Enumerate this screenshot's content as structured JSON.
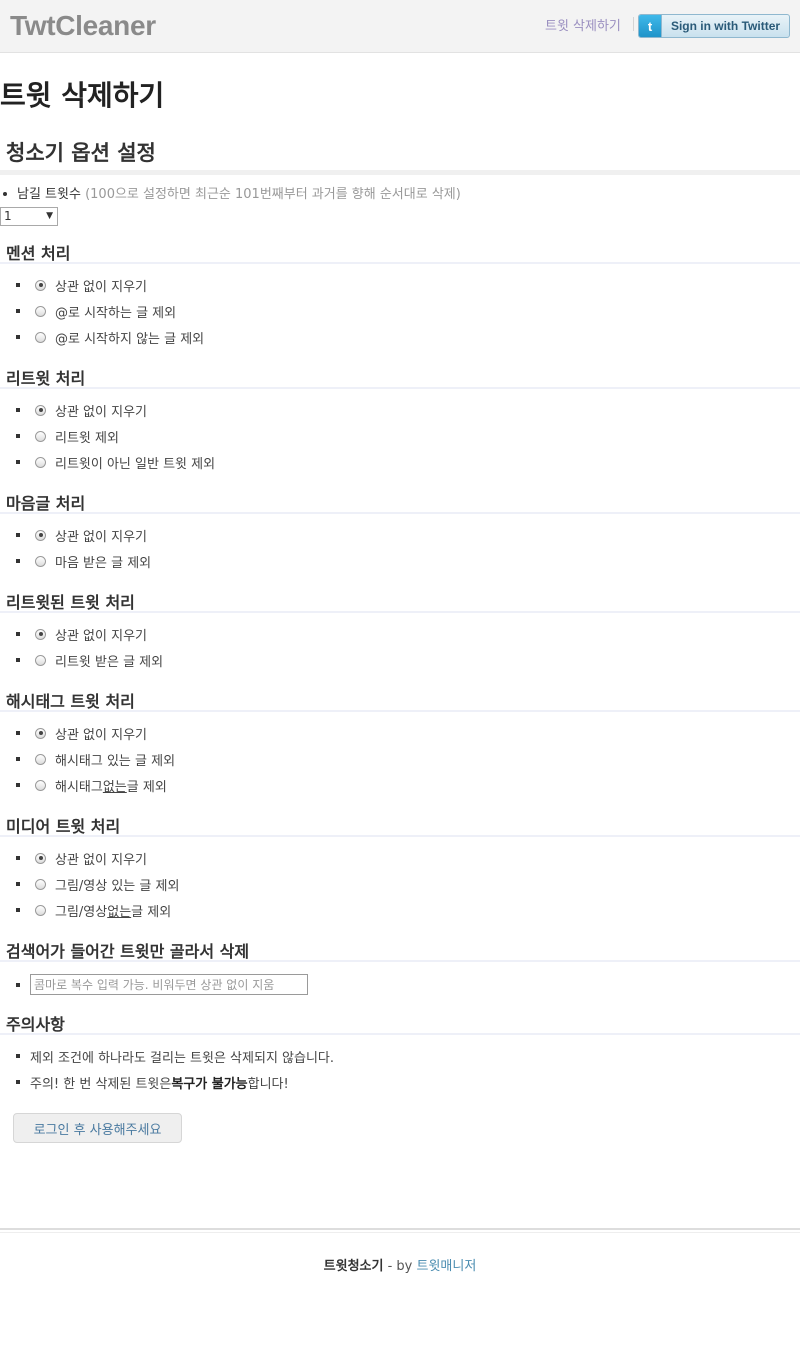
{
  "header": {
    "brand": "TwtCleaner",
    "nav_delete_link": "트윗 삭제하기",
    "signin_label": "Sign in with Twitter",
    "signin_icon": "t"
  },
  "page": {
    "title": "트윗 삭제하기",
    "section_title": "청소기 옵션 설정"
  },
  "keep": {
    "label": "남길 트윗수",
    "hint": "(100으로 설정하면 최근순 101번째부터 과거를 향해 순서대로 삭제)",
    "selected": "1"
  },
  "groups": {
    "mention": {
      "title": "멘션 처리",
      "options": [
        "상관 없이 지우기",
        "@로 시작하는 글 제외",
        "@로 시작하지 않는 글 제외"
      ],
      "selected_index": 0
    },
    "retweet": {
      "title": "리트윗 처리",
      "options": [
        "상관 없이 지우기",
        "리트윗 제외",
        "리트윗이 아닌 일반 트윗 제외"
      ],
      "selected_index": 0
    },
    "favorite": {
      "title": "마음글 처리",
      "options": [
        "상관 없이 지우기",
        "마음 받은 글 제외"
      ],
      "selected_index": 0
    },
    "retweeted": {
      "title": "리트윗된 트윗 처리",
      "options": [
        "상관 없이 지우기",
        "리트윗 받은 글 제외"
      ],
      "selected_index": 0
    },
    "hashtag": {
      "title": "해시태그 트윗 처리",
      "options": [
        "상관 없이 지우기",
        "해시태그 있는 글 제외"
      ],
      "option3_pre": "해시태그 ",
      "option3_u": "없는",
      "option3_post": " 글 제외",
      "selected_index": 0
    },
    "media": {
      "title": "미디어 트윗 처리",
      "options": [
        "상관 없이 지우기",
        "그림/영상 있는 글 제외"
      ],
      "option3_pre": "그림/영상 ",
      "option3_u": "없는",
      "option3_post": " 글 제외",
      "selected_index": 0
    }
  },
  "search": {
    "title": "검색어가 들어간 트윗만 골라서 삭제",
    "placeholder": "콤마로 복수 입력 가능. 비워두면 상관 없이 지움"
  },
  "notes": {
    "title": "주의사항",
    "note1": "제외 조건에 하나라도 걸리는 트윗은 삭제되지 않습니다.",
    "note2_pre": "주의! 한 번 삭제된 트윗은 ",
    "note2_bold": "복구가 불가능",
    "note2_post": "합니다!"
  },
  "login_button": "로그인 후 사용해주세요",
  "footer": {
    "name": "트윗청소기",
    "by": " - by ",
    "author": "트윗매니저"
  }
}
